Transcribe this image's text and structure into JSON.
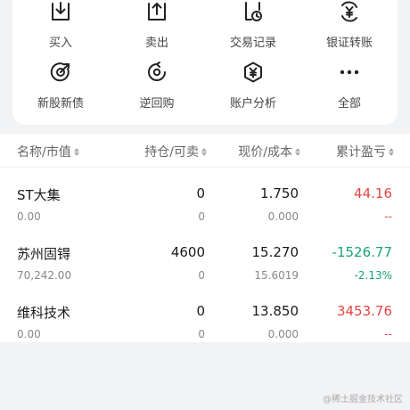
{
  "menu": {
    "row1": [
      {
        "label": "买入",
        "icon": "download-box-icon"
      },
      {
        "label": "卖出",
        "icon": "upload-box-icon"
      },
      {
        "label": "交易记录",
        "icon": "document-clock-icon"
      },
      {
        "label": "银证转账",
        "icon": "yuan-transfer-icon"
      }
    ],
    "row2": [
      {
        "label": "新股新债",
        "icon": "target-icon"
      },
      {
        "label": "逆回购",
        "icon": "reverse-repo-icon"
      },
      {
        "label": "账户分析",
        "icon": "yuan-shield-icon"
      },
      {
        "label": "全部",
        "icon": "more-dots-icon"
      }
    ]
  },
  "table": {
    "headers": [
      "名称/市值",
      "持仓/可卖",
      "现价/成本",
      "累计盈亏"
    ],
    "rows": [
      {
        "name": "ST大集",
        "market_value": "0.00",
        "position": "0",
        "available": "0",
        "price": "1.750",
        "cost": "0.000",
        "pnl": "44.16",
        "pnl_pct": "--",
        "pnl_color": "#e54545",
        "pct_color": "#e54545"
      },
      {
        "name": "苏州固锝",
        "market_value": "70,242.00",
        "position": "4600",
        "available": "0",
        "price": "15.270",
        "cost": "15.6019",
        "pnl": "-1526.77",
        "pnl_pct": "-2.13%",
        "pnl_color": "#1aa179",
        "pct_color": "#1aa179"
      },
      {
        "name": "维科技术",
        "market_value": "0.00",
        "position": "0",
        "available": "0",
        "price": "13.850",
        "cost": "0.000",
        "pnl": "3453.76",
        "pnl_pct": "--",
        "pnl_color": "#e54545",
        "pct_color": "#e54545"
      }
    ]
  },
  "watermark": "@稀土掘金技术社区"
}
